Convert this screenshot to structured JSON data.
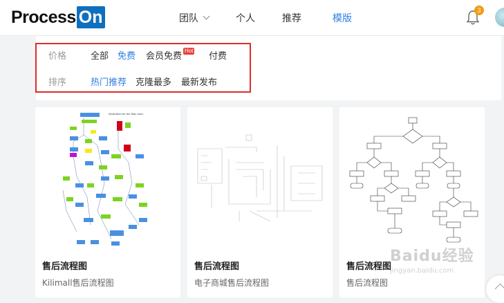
{
  "header": {
    "logo_part1": "Process",
    "logo_part2": "On",
    "nav": [
      "团队",
      "个人",
      "推荐",
      "模版"
    ],
    "notification_count": "3"
  },
  "filter": {
    "price_label": "价格",
    "price_options": [
      "全部",
      "免费",
      "会员免费",
      "付费"
    ],
    "price_active": "免费",
    "hot_badge": "Hot",
    "sort_label": "排序",
    "sort_options": [
      "热门推荐",
      "克隆最多",
      "最新发布"
    ],
    "sort_active": "热门推荐"
  },
  "cards": [
    {
      "title": "售后流程图",
      "subtitle": "Kilimall售后流程图",
      "thumb_caption": "Illustration for the flow chart"
    },
    {
      "title": "售后流程图",
      "subtitle": "电子商城售后流程图"
    },
    {
      "title": "售后流程图",
      "subtitle": "售后流程图"
    }
  ],
  "watermark": {
    "main": "Baidu经验",
    "sub": "jingyan.baidu.com"
  },
  "colors": {
    "accent": "#2f7fe0",
    "highlight_border": "#e02a2a",
    "hot_badge": "#e8413a",
    "badge": "#f39c12"
  }
}
